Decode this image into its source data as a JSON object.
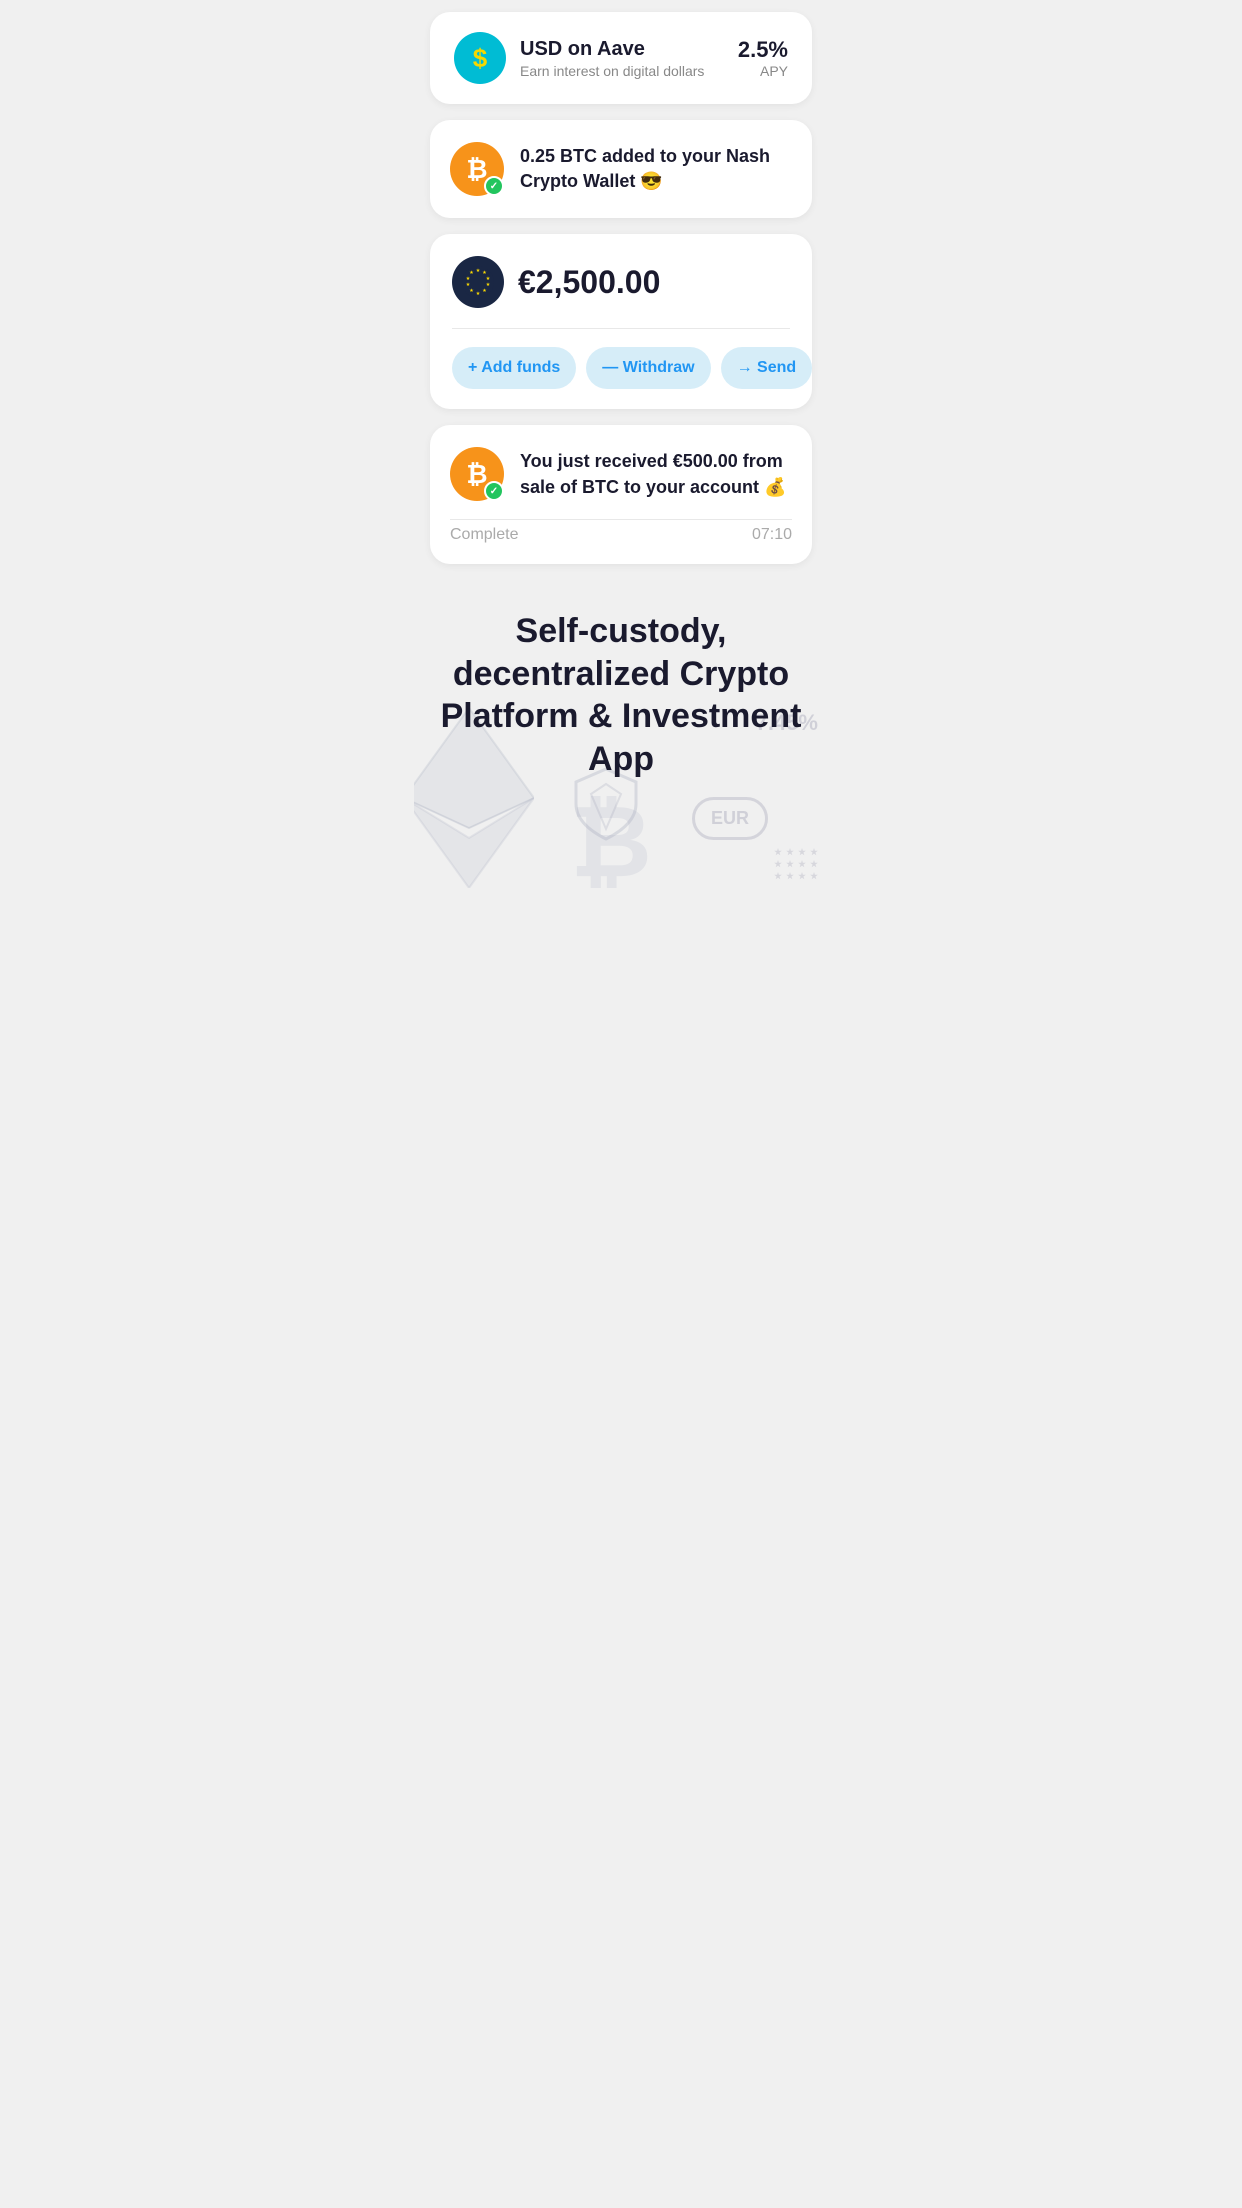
{
  "cards": {
    "aave": {
      "icon_symbol": "$",
      "title": "USD on Aave",
      "subtitle": "Earn interest on digital dollars",
      "apy_value": "2.5%",
      "apy_label": "APY"
    },
    "btc_notification": {
      "message": "0.25 BTC added to your Nash Crypto Wallet 😎"
    },
    "eur_balance": {
      "amount": "€2,500.00",
      "btn_add": "+ Add funds",
      "btn_withdraw": "— Withdraw",
      "btn_send": "→ Send"
    },
    "btc_received": {
      "message": "You just received €500.00 from sale of BTC to your account 💰",
      "status": "Complete",
      "time": "07:10"
    }
  },
  "hero": {
    "title": "Self-custody, decentralized Crypto Platform & Investment App",
    "bg_percent": "7.45%",
    "bg_eur_label": "EUR"
  }
}
